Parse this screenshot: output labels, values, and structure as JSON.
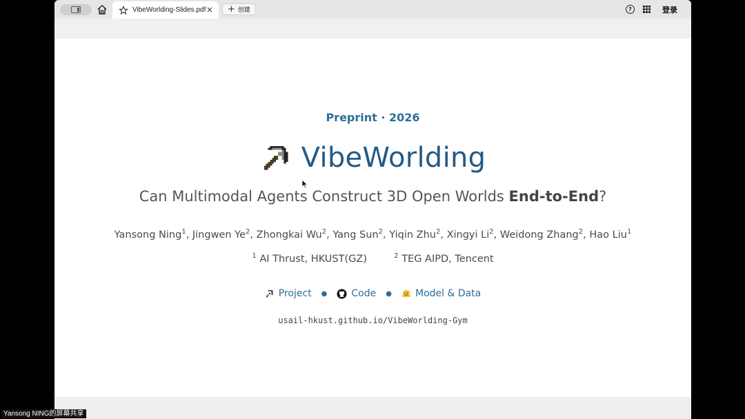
{
  "browser": {
    "tab_title": "VibeWorlding-Slides.pdf",
    "tab_close": "×",
    "new_tab_label": "创建",
    "help_label": "?",
    "login_label": "登录"
  },
  "slide": {
    "preprint": "Preprint · 2026",
    "title": "VibeWorlding",
    "subtitle_pre": "Can Multimodal Agents Construct 3D Open Worlds ",
    "subtitle_bold": "End-to-End",
    "subtitle_post": "?",
    "authors": [
      {
        "name": "Yansong Ning",
        "sup": "1"
      },
      {
        "name": "Jingwen Ye",
        "sup": "2"
      },
      {
        "name": "Zhongkai Wu",
        "sup": "2"
      },
      {
        "name": "Yang Sun",
        "sup": "2"
      },
      {
        "name": "Yiqin Zhu",
        "sup": "2"
      },
      {
        "name": "Xingyi Li",
        "sup": "2"
      },
      {
        "name": "Weidong Zhang",
        "sup": "2"
      },
      {
        "name": "Hao Liu",
        "sup": "1"
      }
    ],
    "affiliations": [
      {
        "sup": "1",
        "name": "AI Thrust, HKUST(GZ)"
      },
      {
        "sup": "2",
        "name": "TEG AIPD, Tencent"
      }
    ],
    "links": {
      "project": "Project",
      "code": "Code",
      "model_data": "Model & Data",
      "separator": "●"
    },
    "url": "usail-hkust.github.io/VibeWorlding-Gym"
  },
  "screen_share_caption": "Yansong NING的屏幕共享",
  "colors": {
    "accent": "#2e6e99",
    "title": "#245a86"
  }
}
